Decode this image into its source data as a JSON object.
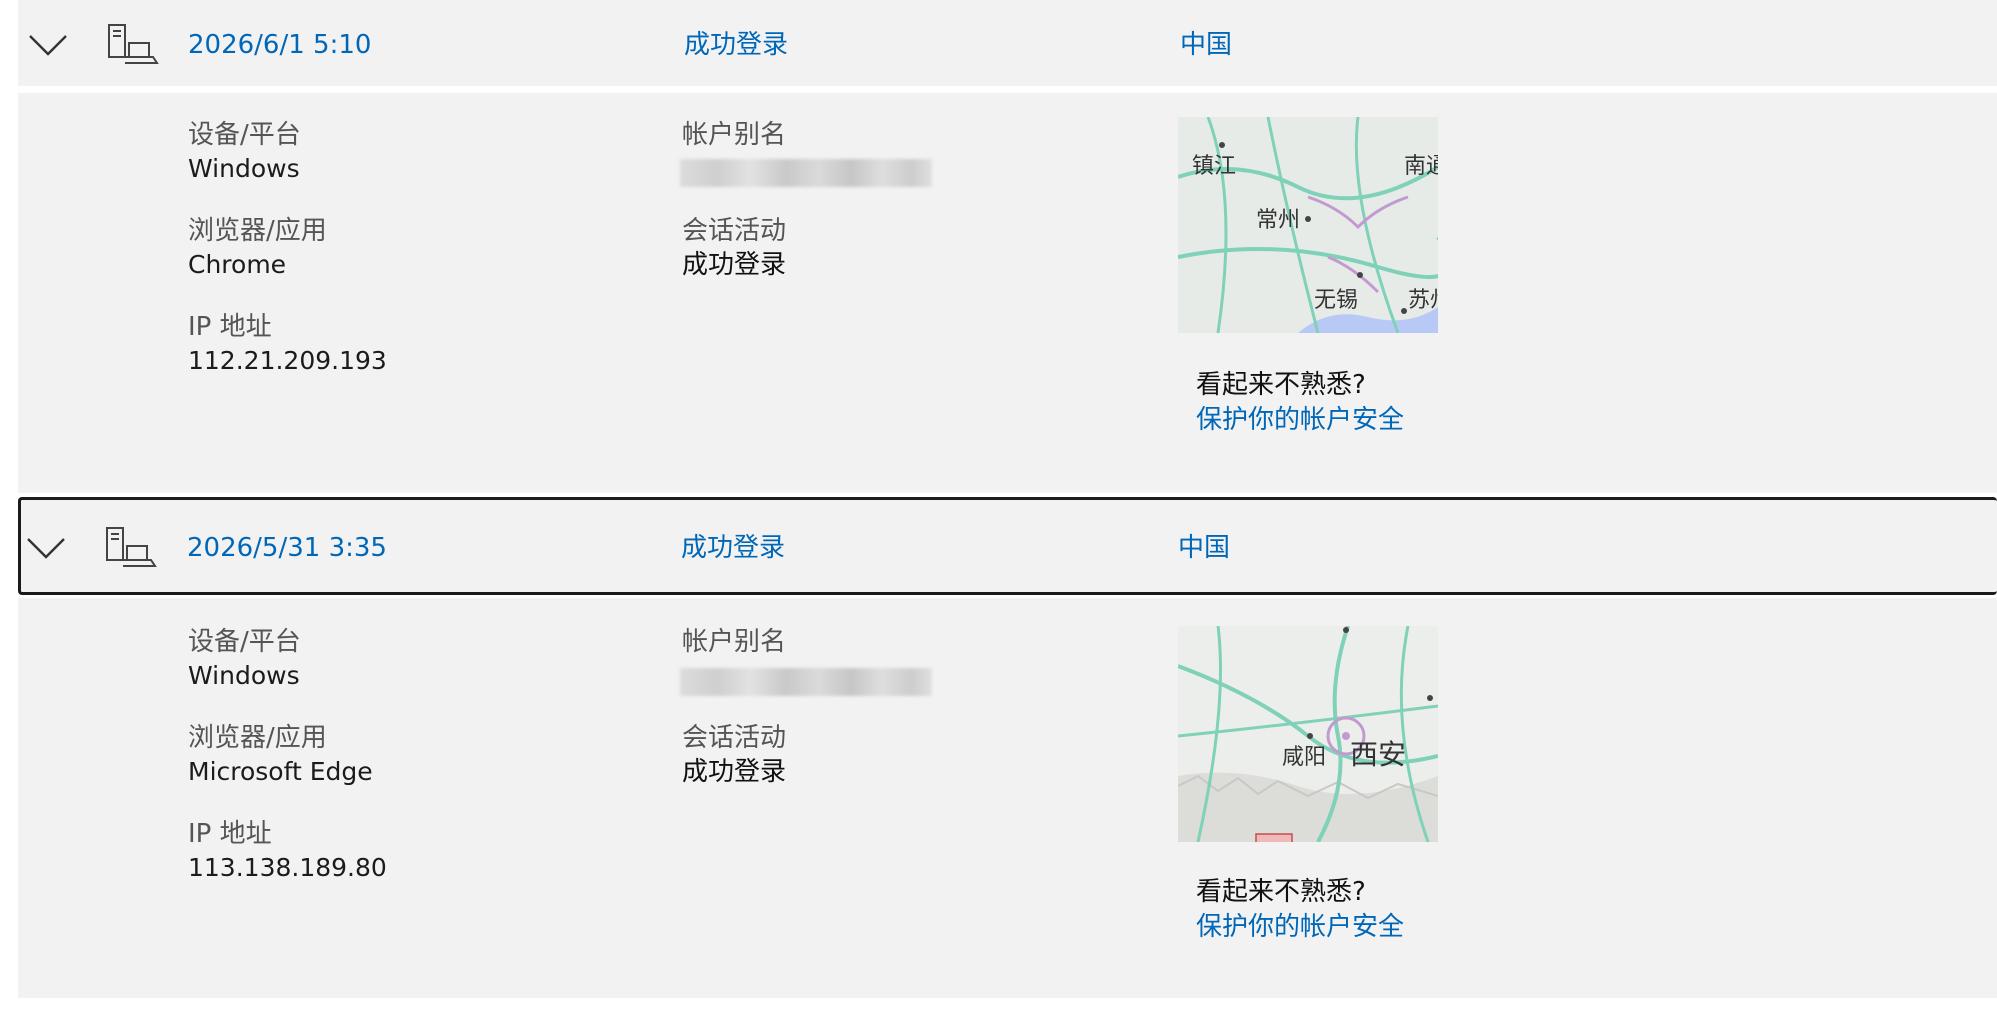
{
  "entries": [
    {
      "datetime": "2026/6/1 5:10",
      "result": "成功登录",
      "location": "中国",
      "device_label": "设备/平台",
      "device_value": "Windows",
      "browser_label": "浏览器/应用",
      "browser_value": "Chrome",
      "ip_label": "IP 地址",
      "ip_value": "112.21.209.193",
      "alias_label": "帐户别名",
      "session_label": "会话活动",
      "session_value": "成功登录",
      "map_labels": [
        "镇江",
        "南通",
        "常州",
        "无锡",
        "苏州"
      ],
      "unfamiliar": "看起来不熟悉?",
      "secure_link": "保护你的帐户安全"
    },
    {
      "datetime": "2026/5/31 3:35",
      "result": "成功登录",
      "location": "中国",
      "device_label": "设备/平台",
      "device_value": "Windows",
      "browser_label": "浏览器/应用",
      "browser_value": "Microsoft Edge",
      "ip_label": "IP 地址",
      "ip_value": "113.138.189.80",
      "alias_label": "帐户别名",
      "session_label": "会话活动",
      "session_value": "成功登录",
      "map_labels": [
        "咸阳",
        "西安"
      ],
      "unfamiliar": "看起来不熟悉?",
      "secure_link": "保护你的帐户安全"
    }
  ],
  "icons": {
    "expand": "chevron-down-icon",
    "device": "computer-icon",
    "map": "map-thumbnail"
  }
}
